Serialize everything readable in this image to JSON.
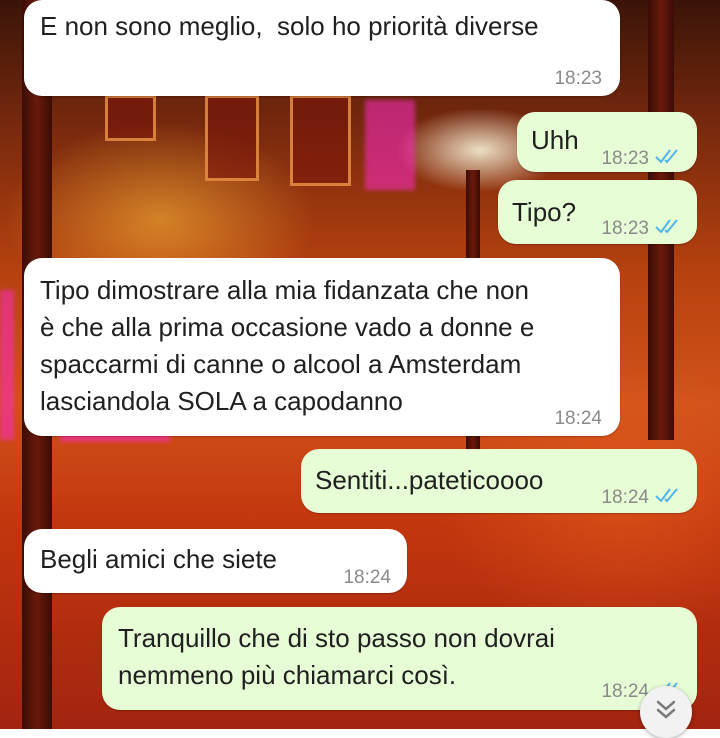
{
  "colors": {
    "incoming_bubble": "#ffffff",
    "outgoing_bubble": "#e7fdd6",
    "read_ticks": "#4fb6ec",
    "timestamp": "#8a8a8a"
  },
  "wallpaper": {
    "description_icon": "red-light-street-wallpaper"
  },
  "messages": [
    {
      "direction": "in",
      "text": "E non sono meglio,  solo ho priorità diverse",
      "time": "18:23"
    },
    {
      "direction": "out",
      "text": "Uhh",
      "time": "18:23",
      "status": "read"
    },
    {
      "direction": "out",
      "text": "Tipo?",
      "time": "18:23",
      "status": "read"
    },
    {
      "direction": "in",
      "lines": [
        "Tipo dimostrare alla mia fidanzata che non",
        "è che alla prima occasione vado a donne e",
        "spaccarmi di canne o alcool a Amsterdam",
        "lasciandola SOLA a capodanno"
      ],
      "time": "18:24"
    },
    {
      "direction": "out",
      "text": "Sentiti...pateticoooo",
      "time": "18:24",
      "status": "read"
    },
    {
      "direction": "in",
      "text": "Begli amici che siete",
      "time": "18:24"
    },
    {
      "direction": "out",
      "lines": [
        "Tranquillo che di sto passo non dovrai",
        "nemmeno più chiamarci così."
      ],
      "time": "18:24",
      "status": "read"
    }
  ],
  "scroll_button": {
    "icon": "double-chevron-down-icon"
  }
}
